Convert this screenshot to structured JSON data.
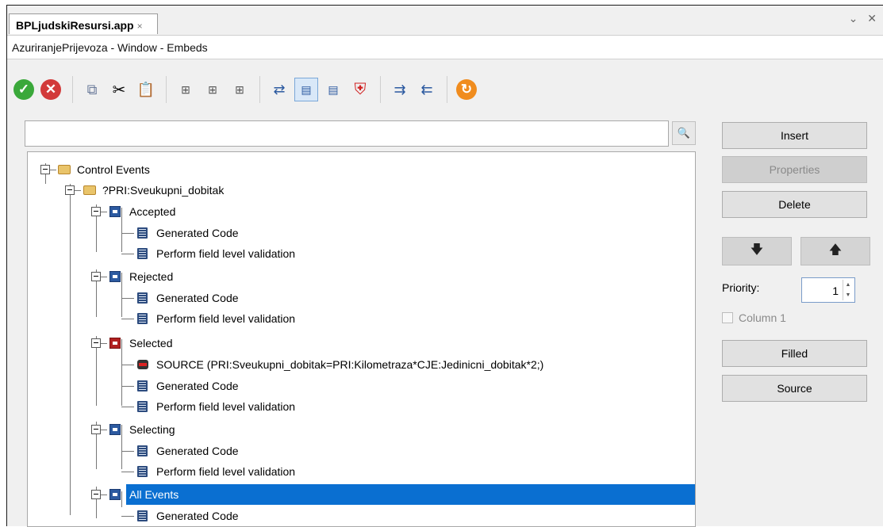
{
  "tab": {
    "title": "BPLjudskiResursi.app",
    "close": "×",
    "controls": "⌄ ✕"
  },
  "window_title": "AzuriranjePrijevoza - Window - Embeds",
  "toolbar": {
    "icons": [
      "ok-icon",
      "cancel-icon",
      "copy-icon",
      "cut-icon",
      "paste-icon",
      "insert-before-icon",
      "insert-after-icon",
      "insert-child-icon",
      "move-left-icon",
      "view-icon",
      "view-alt-icon",
      "shield-icon",
      "indent-icon",
      "outdent-icon",
      "refresh-icon"
    ]
  },
  "search": {
    "value": "",
    "placeholder": ""
  },
  "tree": {
    "root": "Control Events",
    "field": "?PRI:Sveukupni_dobitak",
    "events": [
      {
        "label": "Accepted",
        "children": [
          "Generated Code",
          "Perform field level validation"
        ]
      },
      {
        "label": "Rejected",
        "children": [
          "Generated Code",
          "Perform field level validation"
        ]
      },
      {
        "label": "Selected",
        "source": "SOURCE (PRI:Sveukupni_dobitak=PRI:Kilometraza*CJE:Jedinicni_dobitak*2;)",
        "children": [
          "Generated Code",
          "Perform field level validation"
        ]
      },
      {
        "label": "Selecting",
        "children": [
          "Generated Code",
          "Perform field level validation"
        ]
      },
      {
        "label": "All Events",
        "children": [
          "Generated Code"
        ]
      }
    ]
  },
  "buttons": {
    "insert": "Insert",
    "properties": "Properties",
    "delete": "Delete",
    "down": "🡇",
    "up": "🡅",
    "filled": "Filled",
    "source": "Source"
  },
  "priority": {
    "label": "Priority:",
    "value": "1"
  },
  "column": {
    "label": "Column 1",
    "checked": false
  },
  "colors": {
    "selection": "#0a6fd1",
    "ok": "#3aa83a",
    "cancel": "#d23a3a",
    "refresh": "#f08c1e"
  }
}
